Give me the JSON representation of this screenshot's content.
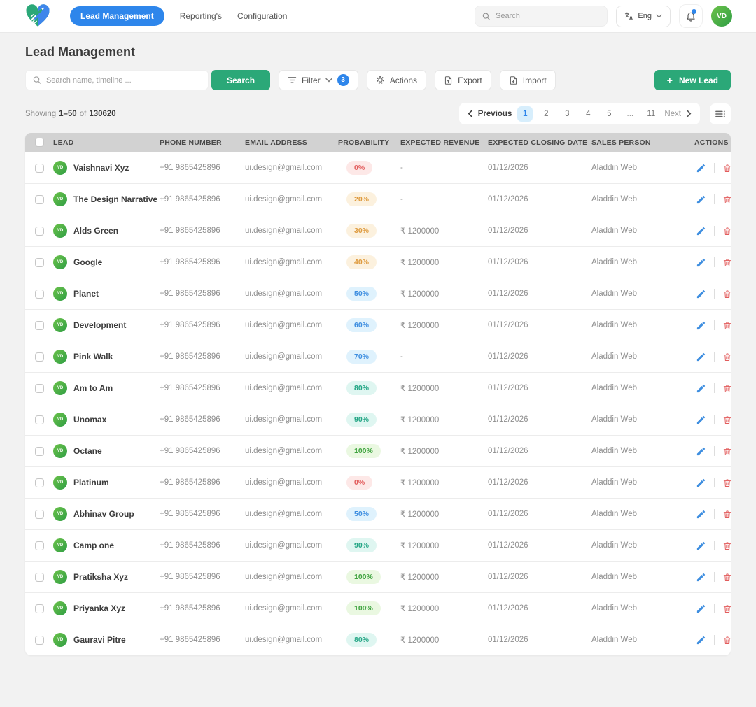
{
  "colors": {
    "accent_blue": "#2E86EB",
    "accent_green": "#2BA878",
    "thead_bg": "#D2D2D2",
    "badge_red_text": "#E25C5C",
    "badge_orange_text": "#DE9A3D",
    "badge_blue_text": "#3E8EE0",
    "badge_teal_text": "#22A584",
    "badge_green_text": "#3FA33F"
  },
  "topnav": {
    "nav_items": [
      {
        "label": "Lead Management",
        "active": true
      },
      {
        "label": "Reporting's",
        "active": false
      },
      {
        "label": "Configuration",
        "active": false
      }
    ],
    "search_placeholder": "Search",
    "language": "Eng",
    "avatar_initials": "VD"
  },
  "page": {
    "title": "Lead Management"
  },
  "toolbar": {
    "search_placeholder": "Search name, timeline ...",
    "search_button": "Search",
    "filter_label": "Filter",
    "filter_count": "3",
    "actions_label": "Actions",
    "export_label": "Export",
    "import_label": "Import",
    "new_lead_plus": "+",
    "new_lead_label": "New Lead"
  },
  "summary": {
    "showing_label": "Showing",
    "range": "1–50",
    "of_label": "of",
    "total": "130620"
  },
  "pagination": {
    "previous_label": "Previous",
    "pages": [
      "1",
      "2",
      "3",
      "4",
      "5",
      "...",
      "11"
    ],
    "active_page": "1",
    "next_label": "Next"
  },
  "table": {
    "headers": [
      "LEAD",
      "PHONE NUMBER",
      "EMAIL ADDRESS",
      "PROBABILITY",
      "EXPECTED REVENUE",
      "EXPECTED CLOSING DATE",
      "SALES PERSON",
      "ACTIONS"
    ],
    "rows": [
      {
        "avatar": "VD",
        "name": "Vaishnavi Xyz",
        "phone": "+91 9865425896",
        "email": "ui.design@gmail.com",
        "probability": "0%",
        "tone": "red",
        "revenue": "-",
        "closing_date": "01/12/2026",
        "sales_person": "Aladdin Web"
      },
      {
        "avatar": "VD",
        "name": "The Design Narrative",
        "phone": "+91 9865425896",
        "email": "ui.design@gmail.com",
        "probability": "20%",
        "tone": "orange",
        "revenue": "-",
        "closing_date": "01/12/2026",
        "sales_person": "Aladdin Web"
      },
      {
        "avatar": "VD",
        "name": "Alds Green",
        "phone": "+91 9865425896",
        "email": "ui.design@gmail.com",
        "probability": "30%",
        "tone": "orange",
        "revenue": "₹ 1200000",
        "closing_date": "01/12/2026",
        "sales_person": "Aladdin Web"
      },
      {
        "avatar": "VD",
        "name": "Google",
        "phone": "+91 9865425896",
        "email": "ui.design@gmail.com",
        "probability": "40%",
        "tone": "orange",
        "revenue": "₹ 1200000",
        "closing_date": "01/12/2026",
        "sales_person": "Aladdin Web"
      },
      {
        "avatar": "VD",
        "name": "Planet",
        "phone": "+91 9865425896",
        "email": "ui.design@gmail.com",
        "probability": "50%",
        "tone": "blue",
        "revenue": "₹ 1200000",
        "closing_date": "01/12/2026",
        "sales_person": "Aladdin Web"
      },
      {
        "avatar": "VD",
        "name": "Development",
        "phone": "+91 9865425896",
        "email": "ui.design@gmail.com",
        "probability": "60%",
        "tone": "blue",
        "revenue": "₹ 1200000",
        "closing_date": "01/12/2026",
        "sales_person": "Aladdin Web"
      },
      {
        "avatar": "VD",
        "name": "Pink Walk",
        "phone": "+91 9865425896",
        "email": "ui.design@gmail.com",
        "probability": "70%",
        "tone": "blue",
        "revenue": "-",
        "closing_date": "01/12/2026",
        "sales_person": "Aladdin Web"
      },
      {
        "avatar": "VD",
        "name": "Am to Am",
        "phone": "+91 9865425896",
        "email": "ui.design@gmail.com",
        "probability": "80%",
        "tone": "teal",
        "revenue": "₹ 1200000",
        "closing_date": "01/12/2026",
        "sales_person": "Aladdin Web"
      },
      {
        "avatar": "VD",
        "name": "Unomax",
        "phone": "+91 9865425896",
        "email": "ui.design@gmail.com",
        "probability": "90%",
        "tone": "teal",
        "revenue": "₹ 1200000",
        "closing_date": "01/12/2026",
        "sales_person": "Aladdin Web"
      },
      {
        "avatar": "VD",
        "name": "Octane",
        "phone": "+91 9865425896",
        "email": "ui.design@gmail.com",
        "probability": "100%",
        "tone": "green",
        "revenue": "₹ 1200000",
        "closing_date": "01/12/2026",
        "sales_person": "Aladdin Web"
      },
      {
        "avatar": "VD",
        "name": "Platinum",
        "phone": "+91 9865425896",
        "email": "ui.design@gmail.com",
        "probability": "0%",
        "tone": "red",
        "revenue": "₹ 1200000",
        "closing_date": "01/12/2026",
        "sales_person": "Aladdin Web"
      },
      {
        "avatar": "VD",
        "name": "Abhinav Group",
        "phone": "+91 9865425896",
        "email": "ui.design@gmail.com",
        "probability": "50%",
        "tone": "blue",
        "revenue": "₹ 1200000",
        "closing_date": "01/12/2026",
        "sales_person": "Aladdin Web"
      },
      {
        "avatar": "VD",
        "name": "Camp one",
        "phone": "+91 9865425896",
        "email": "ui.design@gmail.com",
        "probability": "90%",
        "tone": "teal",
        "revenue": "₹ 1200000",
        "closing_date": "01/12/2026",
        "sales_person": "Aladdin Web"
      },
      {
        "avatar": "VD",
        "name": "Pratiksha Xyz",
        "phone": "+91 9865425896",
        "email": "ui.design@gmail.com",
        "probability": "100%",
        "tone": "green",
        "revenue": "₹ 1200000",
        "closing_date": "01/12/2026",
        "sales_person": "Aladdin Web"
      },
      {
        "avatar": "VD",
        "name": "Priyanka Xyz",
        "phone": "+91 9865425896",
        "email": "ui.design@gmail.com",
        "probability": "100%",
        "tone": "green",
        "revenue": "₹ 1200000",
        "closing_date": "01/12/2026",
        "sales_person": "Aladdin Web"
      },
      {
        "avatar": "VD",
        "name": "Gauravi Pitre",
        "phone": "+91 9865425896",
        "email": "ui.design@gmail.com",
        "probability": "80%",
        "tone": "teal",
        "revenue": "₹ 1200000",
        "closing_date": "01/12/2026",
        "sales_person": "Aladdin Web"
      }
    ]
  }
}
